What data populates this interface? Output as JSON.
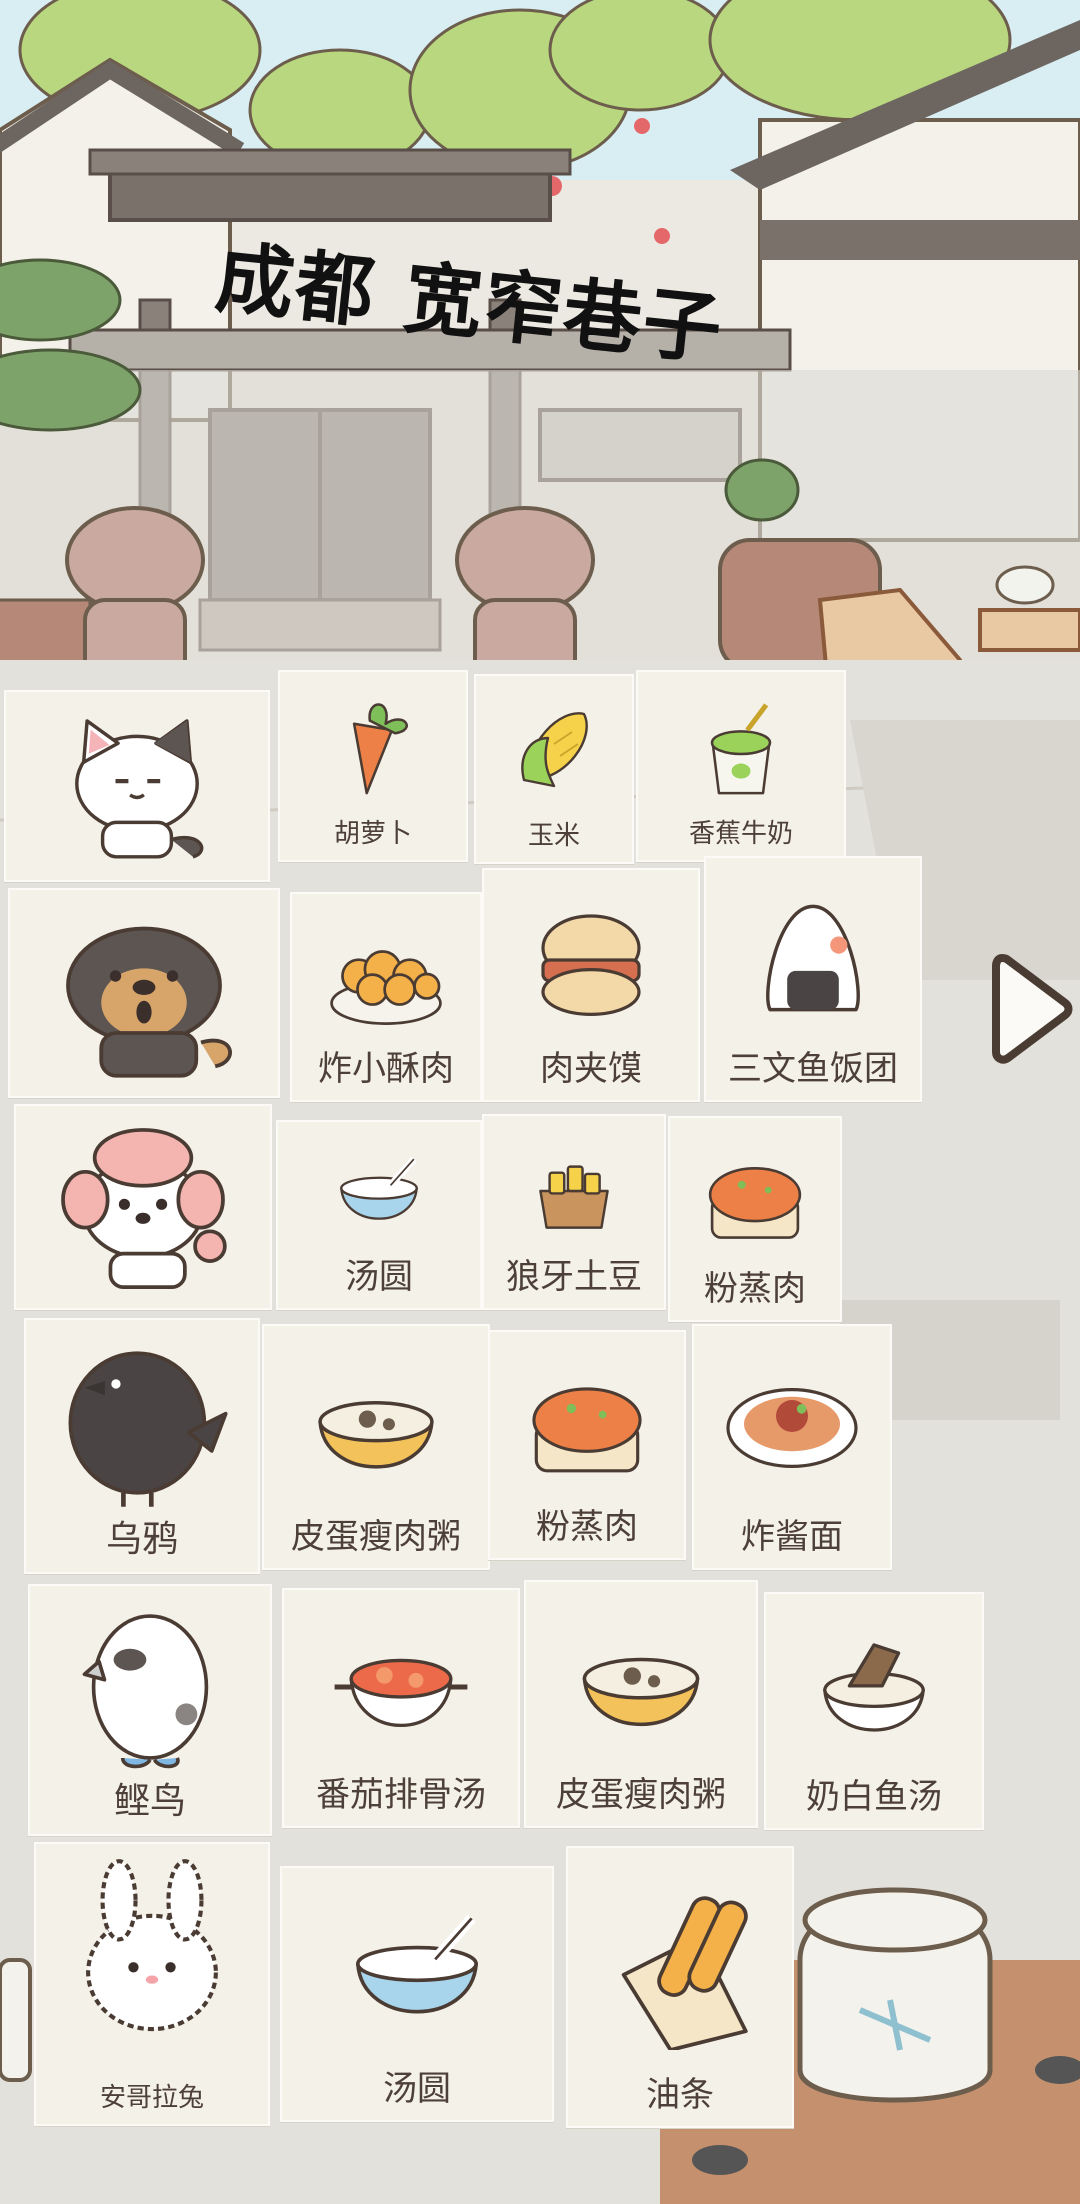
{
  "title": "成都 宽窄巷子",
  "rows": [
    {
      "animal": {
        "name": "",
        "icon": "cat-icon"
      },
      "foods": [
        {
          "label": "胡萝卜",
          "icon": "carrot-icon"
        },
        {
          "label": "玉米",
          "icon": "corn-icon"
        },
        {
          "label": "香蕉牛奶",
          "icon": "banana-milk-icon"
        }
      ]
    },
    {
      "animal": {
        "name": "",
        "icon": "dog-icon"
      },
      "foods": [
        {
          "label": "炸小酥肉",
          "icon": "fried-pork-icon"
        },
        {
          "label": "肉夹馍",
          "icon": "burger-icon"
        },
        {
          "label": "三文鱼饭团",
          "icon": "onigiri-icon"
        }
      ]
    },
    {
      "animal": {
        "name": "",
        "icon": "poodle-icon"
      },
      "foods": [
        {
          "label": "汤圆",
          "icon": "rice-ball-bowl-icon"
        },
        {
          "label": "狼牙土豆",
          "icon": "potato-bowl-icon"
        },
        {
          "label": "粉蒸肉",
          "icon": "steamed-pork-icon"
        }
      ]
    },
    {
      "animal": {
        "name": "乌鸦",
        "icon": "crow-icon"
      },
      "foods": [
        {
          "label": "皮蛋瘦肉粥",
          "icon": "congee-icon"
        },
        {
          "label": "粉蒸肉",
          "icon": "steamed-pork-icon"
        },
        {
          "label": "炸酱面",
          "icon": "noodles-icon"
        }
      ]
    },
    {
      "animal": {
        "name": "鲣鸟",
        "icon": "booby-bird-icon"
      },
      "foods": [
        {
          "label": "番茄排骨汤",
          "icon": "tomato-soup-icon"
        },
        {
          "label": "皮蛋瘦肉粥",
          "icon": "congee-icon"
        },
        {
          "label": "奶白鱼汤",
          "icon": "fish-soup-icon"
        }
      ]
    },
    {
      "animal": {
        "name": "安哥拉兔",
        "icon": "rabbit-icon"
      },
      "foods": [
        {
          "label": "汤圆",
          "icon": "rice-ball-bowl-icon"
        },
        {
          "label": "油条",
          "icon": "fried-dough-icon"
        }
      ]
    }
  ],
  "next_button": {
    "icon": "play-arrow-icon"
  }
}
